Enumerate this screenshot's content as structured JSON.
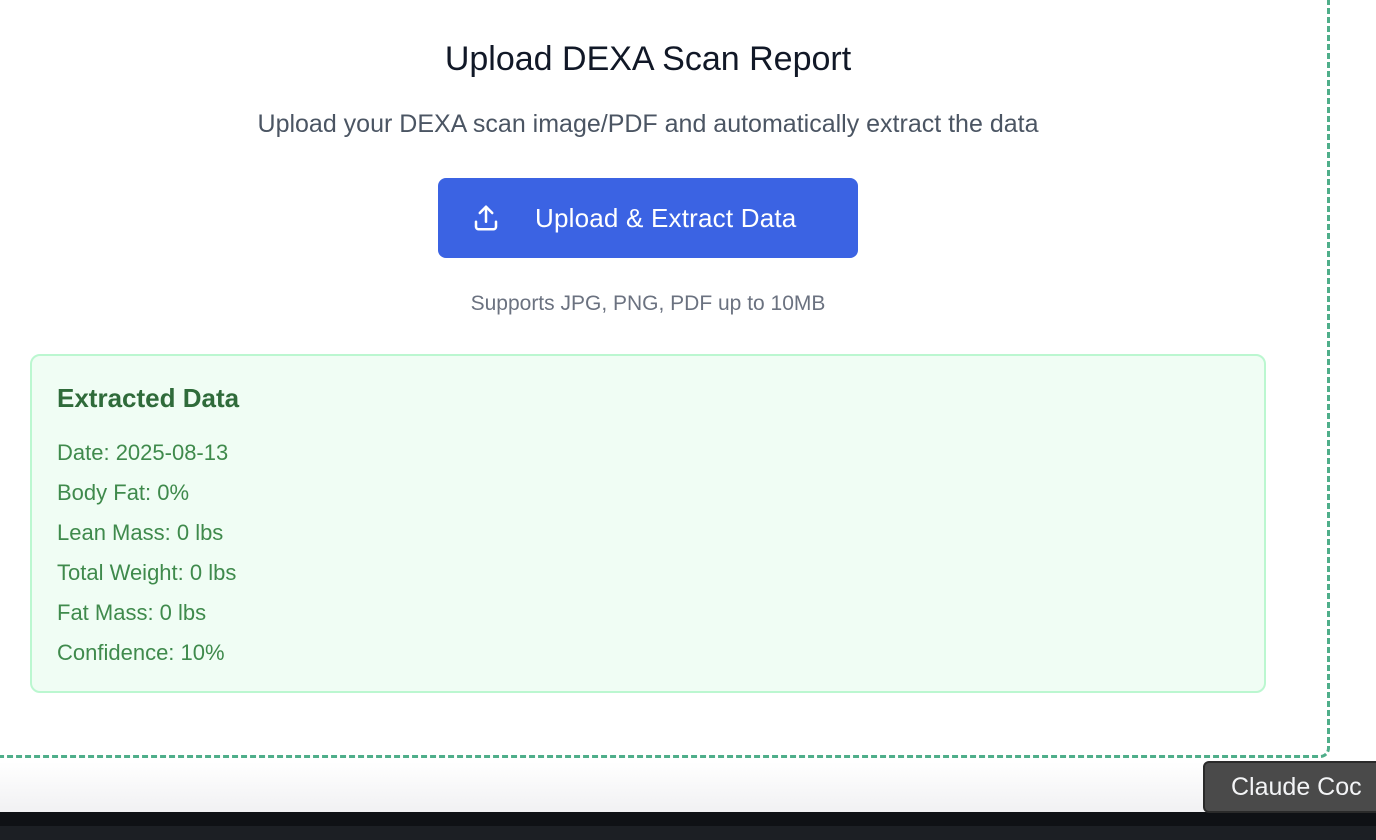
{
  "upload": {
    "title": "Upload DEXA Scan Report",
    "subtitle": "Upload your DEXA scan image/PDF and automatically extract the data",
    "button_label": "Upload & Extract Data",
    "button_icon": "upload-icon",
    "hint": "Supports JPG, PNG, PDF up to 10MB"
  },
  "extracted": {
    "title": "Extracted Data",
    "rows": [
      "Date: 2025-08-13",
      "Body Fat: 0%",
      "Lean Mass: 0 lbs",
      "Total Weight: 0 lbs",
      "Fat Mass: 0 lbs",
      "Confidence: 10%"
    ]
  },
  "taskbar": {
    "tab_label": "Claude Coc"
  },
  "colors": {
    "accent": "#3b63e3",
    "dropzone_border": "#4fae8a",
    "success_bg": "#f0fdf4",
    "success_border": "#bbf7d0",
    "success_title": "#2f6b3a",
    "success_text": "#3f8a4c"
  }
}
